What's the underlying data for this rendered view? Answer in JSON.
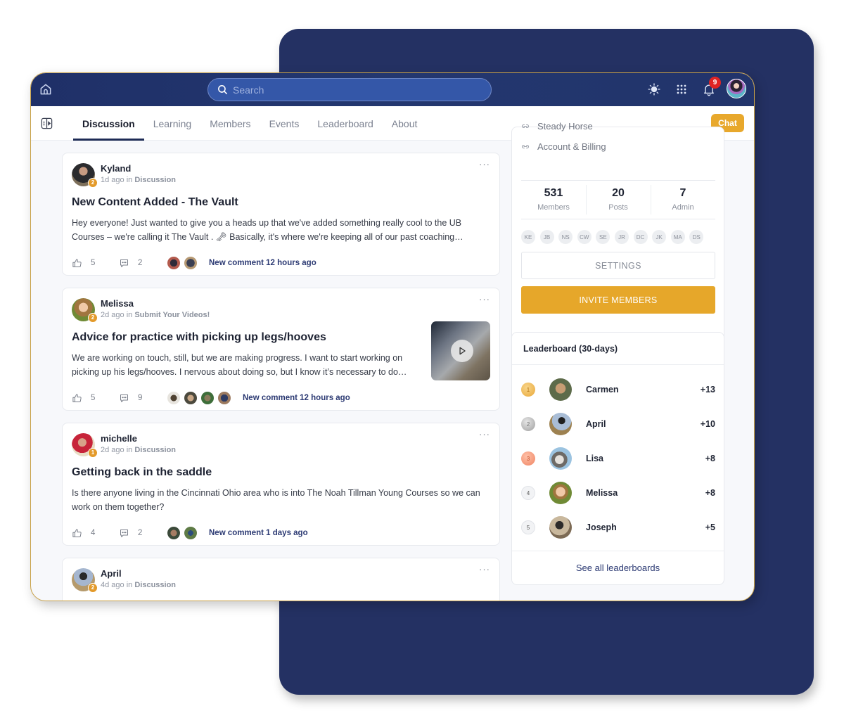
{
  "colors": {
    "topbar": "#1f3068",
    "backdrop": "#243163",
    "accent": "#e6a72a",
    "badge": "#e02424",
    "link": "#2c3a73"
  },
  "topbar": {
    "home_icon": "home-icon",
    "search_placeholder": "Search",
    "theme_icon": "sun-icon",
    "apps_icon": "grid-icon",
    "notifications_icon": "bell-icon",
    "notifications_count": "9",
    "profile_icon": "user-avatar"
  },
  "tabbar": {
    "sidebar_toggle_icon": "sidebar-toggle-icon",
    "tabs": [
      {
        "label": "Discussion",
        "active": true
      },
      {
        "label": "Learning",
        "active": false
      },
      {
        "label": "Members",
        "active": false
      },
      {
        "label": "Events",
        "active": false
      },
      {
        "label": "Leaderboard",
        "active": false
      },
      {
        "label": "About",
        "active": false
      }
    ],
    "chat_label": "Chat"
  },
  "feed": {
    "posts": [
      {
        "author": "Kyland",
        "level": "2",
        "time": "1d ago in",
        "category": "Discussion",
        "title": "New Content Added - The Vault",
        "body": "Hey everyone! Just wanted to give you a heads up that we've added something really cool to the UB Courses – we're calling it The Vault . 🗝 Basically, it's where we're keeping all of our past coaching…",
        "likes": "5",
        "comments": "2",
        "new_comment": "New comment 12 hours ago",
        "commenter_count": 2
      },
      {
        "author": "Melissa",
        "level": "2",
        "time": "2d ago in",
        "category": "Submit Your Videos!",
        "title": "Advice for practice with picking up legs/hooves",
        "body": "We are working on touch, still, but we are making progress. I want to start working on picking up his legs/hooves. I nervous about doing so, but I know it’s necessary to do…",
        "likes": "5",
        "comments": "9",
        "new_comment": "New comment 12 hours ago",
        "commenter_count": 4,
        "has_video": true
      },
      {
        "author": "michelle",
        "level": "1",
        "time": "2d ago in",
        "category": "Discussion",
        "title": "Getting back in the saddle",
        "body": "Is there anyone living in the Cincinnati Ohio area who is into The Noah Tillman Young Courses so we can work on them together?",
        "likes": "4",
        "comments": "2",
        "new_comment": "New comment 1 days ago",
        "commenter_count": 2
      },
      {
        "author": "April",
        "level": "2",
        "time": "4d ago in",
        "category": "Discussion"
      }
    ],
    "more_label": "···"
  },
  "sidebar": {
    "links": [
      {
        "label": "Steady Horse",
        "icon": "link-icon"
      },
      {
        "label": "Account & Billing",
        "icon": "link-icon"
      }
    ],
    "stats": [
      {
        "value": "531",
        "label": "Members"
      },
      {
        "value": "20",
        "label": "Posts"
      },
      {
        "value": "7",
        "label": "Admin"
      }
    ],
    "member_initials": [
      "KE",
      "JB",
      "NS",
      "CW",
      "SE",
      "JR",
      "DC",
      "JK",
      "MA",
      "DS"
    ],
    "settings_label": "SETTINGS",
    "invite_label": "INVITE MEMBERS"
  },
  "leaderboard": {
    "title": "Leaderboard (30-days)",
    "entries": [
      {
        "rank": "1",
        "name": "Carmen",
        "points": "+13"
      },
      {
        "rank": "2",
        "name": "April",
        "points": "+10"
      },
      {
        "rank": "3",
        "name": "Lisa",
        "points": "+8"
      },
      {
        "rank": "4",
        "name": "Melissa",
        "points": "+8"
      },
      {
        "rank": "5",
        "name": "Joseph",
        "points": "+5"
      }
    ],
    "see_all_label": "See all leaderboards"
  }
}
